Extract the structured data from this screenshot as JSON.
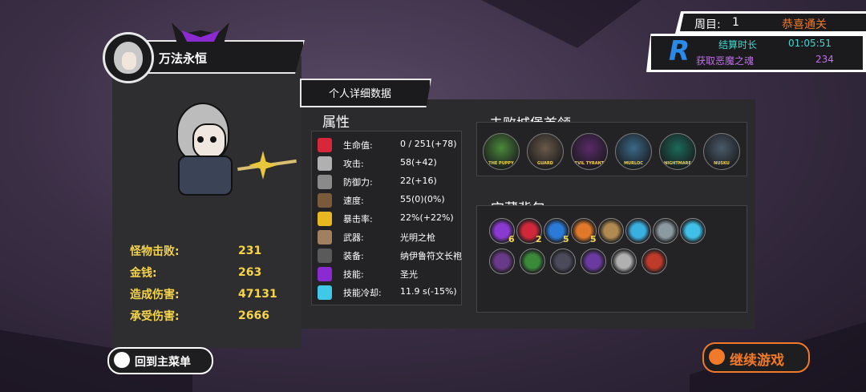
{
  "player": {
    "name": "万法永恒"
  },
  "stats": [
    {
      "label": "怪物击败:",
      "value": "231"
    },
    {
      "label": "金钱:",
      "value": "263"
    },
    {
      "label": "造成伤害:",
      "value": "47131"
    },
    {
      "label": "承受伤害:",
      "value": "2666"
    }
  ],
  "detail_tab": "个人详细数据",
  "attributes": {
    "title": "属性",
    "rows": [
      {
        "label": "生命值:",
        "value": "0 / 251(+78)",
        "icon": "heart-icon",
        "color": "#d8263a"
      },
      {
        "label": "攻击:",
        "value": "58(+42)",
        "icon": "sword-icon",
        "color": "#b0b0b0"
      },
      {
        "label": "防御力:",
        "value": "22(+16)",
        "icon": "shield-icon",
        "color": "#8a8a8a"
      },
      {
        "label": "速度:",
        "value": "55(0)(0%)",
        "icon": "boot-icon",
        "color": "#7a5a3a"
      },
      {
        "label": "暴击率:",
        "value": "22%(+22%)",
        "icon": "crit-sun-icon",
        "color": "#e8b820"
      },
      {
        "label": "武器:",
        "value": "光明之枪",
        "icon": "weapon-icon",
        "color": "#a08060"
      },
      {
        "label": "装备:",
        "value": "纳伊鲁符文长袍",
        "icon": "armor-icon",
        "color": "#5a5a5a"
      },
      {
        "label": "技能:",
        "value": "圣光",
        "icon": "skill-icon",
        "color": "#8a2ad0"
      },
      {
        "label": "技能冷却:",
        "value": "11.9 s(-15%)",
        "icon": "cooldown-icon",
        "color": "#40c8e8"
      }
    ]
  },
  "bosses": {
    "title": "击败城堡首领",
    "list": [
      {
        "label": "THE PUPPY",
        "color": "#4a8a3a"
      },
      {
        "label": "GUARD",
        "color": "#6a5a4a"
      },
      {
        "label": "EVIL TYRANT",
        "color": "#5a2a6a"
      },
      {
        "label": "MURLOC",
        "color": "#3a6a8a"
      },
      {
        "label": "NIGHTMARE",
        "color": "#1a6a5a"
      },
      {
        "label": "NUSKU",
        "color": "#4a5a6a"
      }
    ]
  },
  "treasure": {
    "title": "宝藏背包",
    "row1": [
      {
        "color": "#8a3ad0",
        "count": "6",
        "icon": "purple-crystal-icon"
      },
      {
        "color": "#d0283a",
        "count": "2",
        "icon": "red-crystal-icon"
      },
      {
        "color": "#2a7ad8",
        "count": "5",
        "icon": "blue-crystal-icon"
      },
      {
        "color": "#e07a2a",
        "count": "5",
        "icon": "orange-crystal-icon"
      },
      {
        "color": "#b08a50",
        "count": "",
        "icon": "bag-icon"
      },
      {
        "color": "#3ab0e0",
        "count": "",
        "icon": "ice-shard-icon"
      },
      {
        "color": "#8a9aa0",
        "count": "",
        "icon": "dragon-icon"
      },
      {
        "color": "#40c0e8",
        "count": "",
        "icon": "snowflake-icon"
      }
    ],
    "row2": [
      {
        "color": "#6a3a8a",
        "icon": "shadow-creature-icon"
      },
      {
        "color": "#3a8a3a",
        "icon": "goblin-icon"
      },
      {
        "color": "#4a4a5a",
        "icon": "ghost-icon"
      },
      {
        "color": "#6a3aa0",
        "icon": "dark-blade-icon"
      },
      {
        "color": "#b0b0b0",
        "icon": "helmet-icon"
      },
      {
        "color": "#c03a2a",
        "icon": "amulet-icon"
      }
    ]
  },
  "round": {
    "label": "周目:",
    "value": "1",
    "status": "恭喜通关"
  },
  "result": {
    "time_label": "结算时长",
    "time_value": "01:05:51",
    "souls_label": "获取恶魔之魂",
    "souls_value": "234",
    "badge": "R"
  },
  "buttons": {
    "main_menu": "回到主菜单",
    "continue": "继续游戏"
  }
}
